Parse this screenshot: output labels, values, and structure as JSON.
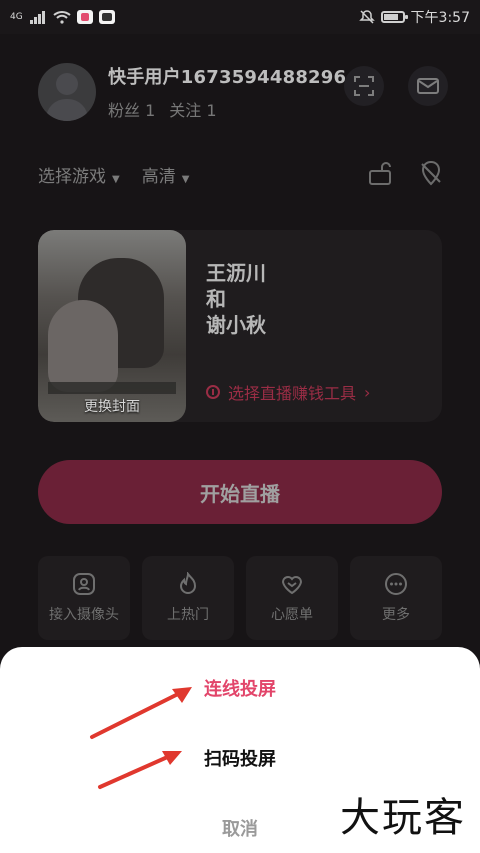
{
  "status_bar": {
    "network": "4G",
    "time": "下午3:57"
  },
  "profile": {
    "username": "快手用户1673594488296",
    "fans": "粉丝 1",
    "following": "关注 1"
  },
  "selectors": {
    "game": "选择游戏",
    "quality": "高清"
  },
  "stream_card": {
    "cover_caption": "更换封面",
    "title_lines": [
      "王沥川",
      "和",
      "谢小秋"
    ],
    "earn_tool": "选择直播赚钱工具",
    "earn_chevron": "›"
  },
  "start_button": "开始直播",
  "tools": [
    {
      "label": "接入摄像头",
      "icon": "camera-person-icon"
    },
    {
      "label": "上热门",
      "icon": "flame-icon"
    },
    {
      "label": "心愿单",
      "icon": "heart-icon"
    },
    {
      "label": "更多",
      "icon": "more-dots-icon"
    }
  ],
  "sheet": {
    "option1": "连线投屏",
    "option2": "扫码投屏",
    "cancel": "取消"
  },
  "watermark": "大玩客",
  "colors": {
    "accent": "#e2456a",
    "start_button": "#6a2036",
    "arrow": "#e0382e"
  }
}
